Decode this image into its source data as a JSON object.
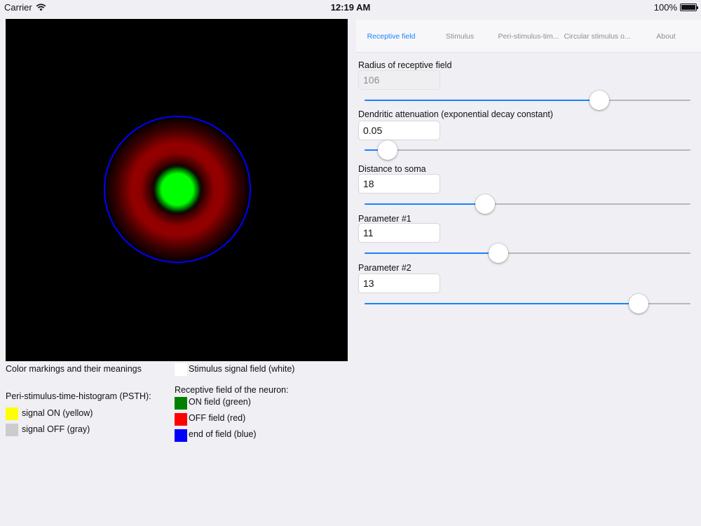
{
  "status_bar": {
    "carrier": "Carrier",
    "time": "12:19 AM",
    "battery": "100%",
    "battery_level": 1.0
  },
  "tabs": [
    {
      "label": "Receptive field",
      "active": true
    },
    {
      "label": "Stimulus",
      "active": false
    },
    {
      "label": "Peri-stimulus-tim...",
      "active": false
    },
    {
      "label": "Circular stimulus o...",
      "active": false
    },
    {
      "label": "About",
      "active": false
    }
  ],
  "fields": {
    "radius": {
      "label": "Radius of receptive field",
      "value": "106",
      "slider_fraction": 0.72
    },
    "dendritic": {
      "label": "Dendritic attenuation (exponential decay constant)",
      "value": "0.05",
      "slider_fraction": 0.07
    },
    "distance": {
      "label": "Distance to soma",
      "value": "18",
      "slider_fraction": 0.37
    },
    "param1": {
      "label": "Parameter #1",
      "value": "11",
      "slider_fraction": 0.41
    },
    "param2": {
      "label": "Parameter #2",
      "value": "13",
      "slider_fraction": 0.84
    }
  },
  "legend": {
    "title": "Color markings and their meanings",
    "stimulus": "Stimulus signal field (white)",
    "psth_title": "Peri-stimulus-time-histogram (PSTH):",
    "signal_on": "signal ON (yellow)",
    "signal_off": "signal OFF (gray)",
    "rf_title": "Receptive field of the neuron:",
    "on_field": "ON field (green)",
    "off_field": "OFF field (red)",
    "end_field": "end of field (blue)"
  },
  "colors": {
    "accent": "#1a82fb",
    "on": "#00ff00",
    "off": "#ff0000",
    "end": "#0000ff",
    "yellow": "#ffff00",
    "gray": "#cccccc",
    "white": "#ffffff",
    "legend_green": "#008000"
  },
  "icons": {
    "wifi": "wifi-icon",
    "battery": "battery-icon"
  }
}
